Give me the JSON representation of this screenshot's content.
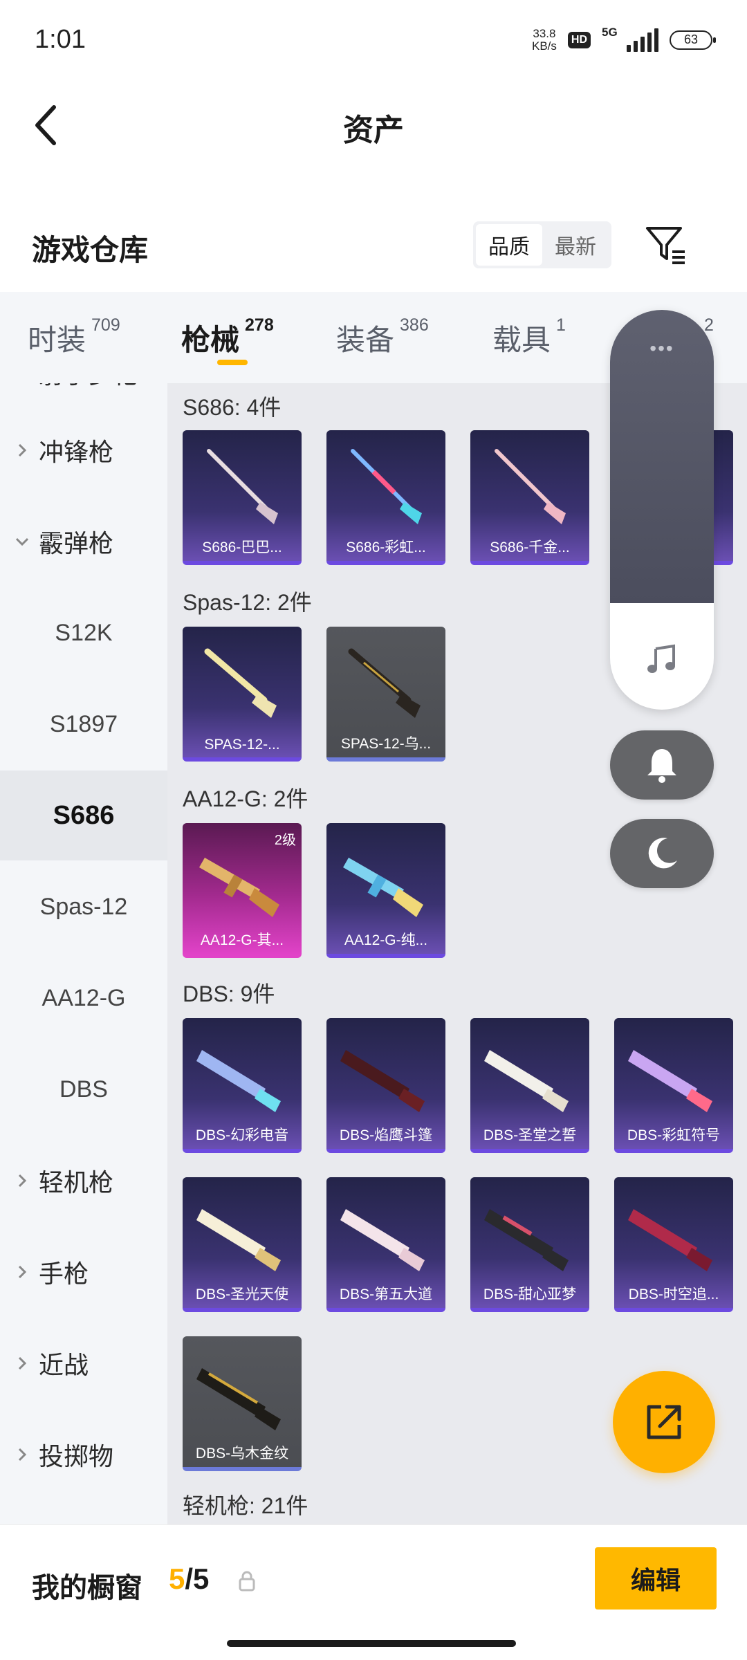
{
  "status_bar": {
    "time": "1:01",
    "net_speed_value": "33.8",
    "net_speed_unit": "KB/s",
    "hd": "HD",
    "net_type": "5G",
    "battery": "63"
  },
  "header": {
    "title": "资产"
  },
  "warehouse": {
    "title": "游戏仓库",
    "sort_options": [
      "品质",
      "最新"
    ],
    "sort_active": "品质"
  },
  "tabs": [
    {
      "label": "时装",
      "count": "709"
    },
    {
      "label": "枪械",
      "count": "278",
      "active": true
    },
    {
      "label": "装备",
      "count": "386"
    },
    {
      "label": "载具",
      "count": "1"
    },
    {
      "label": "",
      "count": "2"
    }
  ],
  "sidebar": {
    "items": [
      {
        "label": "射手步枪",
        "type": "cat"
      },
      {
        "label": "冲锋枪",
        "type": "cat"
      },
      {
        "label": "霰弹枪",
        "type": "cat",
        "expanded": true
      },
      {
        "label": "S12K",
        "type": "sub"
      },
      {
        "label": "S1897",
        "type": "sub"
      },
      {
        "label": "S686",
        "type": "sub",
        "active": true
      },
      {
        "label": "Spas-12",
        "type": "sub"
      },
      {
        "label": "AA12-G",
        "type": "sub"
      },
      {
        "label": "DBS",
        "type": "sub"
      },
      {
        "label": "轻机枪",
        "type": "cat"
      },
      {
        "label": "手枪",
        "type": "cat"
      },
      {
        "label": "近战",
        "type": "cat"
      },
      {
        "label": "投掷物",
        "type": "cat"
      }
    ]
  },
  "groups": [
    {
      "label": "S686: 4件",
      "items": [
        {
          "name": "S686-巴巴...",
          "style": "purple"
        },
        {
          "name": "S686-彩虹...",
          "style": "purple"
        },
        {
          "name": "S686-千金...",
          "style": "purple"
        },
        {
          "name": "",
          "style": "purple"
        }
      ]
    },
    {
      "label": "Spas-12: 2件",
      "items": [
        {
          "name": "SPAS-12-...",
          "style": "purple"
        },
        {
          "name": "SPAS-12-乌...",
          "style": "gray"
        }
      ]
    },
    {
      "label": "AA12-G: 2件",
      "items": [
        {
          "name": "AA12-G-其...",
          "style": "pink",
          "level": "2级"
        },
        {
          "name": "AA12-G-纯...",
          "style": "purple"
        }
      ]
    },
    {
      "label": "DBS: 9件",
      "items": [
        {
          "name": "DBS-幻彩电音",
          "style": "purple"
        },
        {
          "name": "DBS-焰鹰斗篷",
          "style": "purple"
        },
        {
          "name": "DBS-圣堂之誓",
          "style": "purple"
        },
        {
          "name": "DBS-彩虹符号",
          "style": "purple"
        },
        {
          "name": "DBS-圣光天使",
          "style": "purple"
        },
        {
          "name": "DBS-第五大道",
          "style": "purple"
        },
        {
          "name": "DBS-甜心亚梦",
          "style": "purple"
        },
        {
          "name": "DBS-时空追...",
          "style": "purple"
        },
        {
          "name": "DBS-乌木金纹",
          "style": "gray"
        }
      ]
    },
    {
      "label": "轻机枪: 21件",
      "items": []
    }
  ],
  "float_panel": {
    "dots": "•••"
  },
  "bottom": {
    "showcase_label": "我的橱窗",
    "showcase_current": "5",
    "showcase_total": "/5",
    "edit_label": "编辑"
  },
  "colors": {
    "accent": "#ffb800",
    "card_purple": "#3a3270",
    "card_pink": "#e042c7",
    "card_gray": "#4b4d52"
  }
}
